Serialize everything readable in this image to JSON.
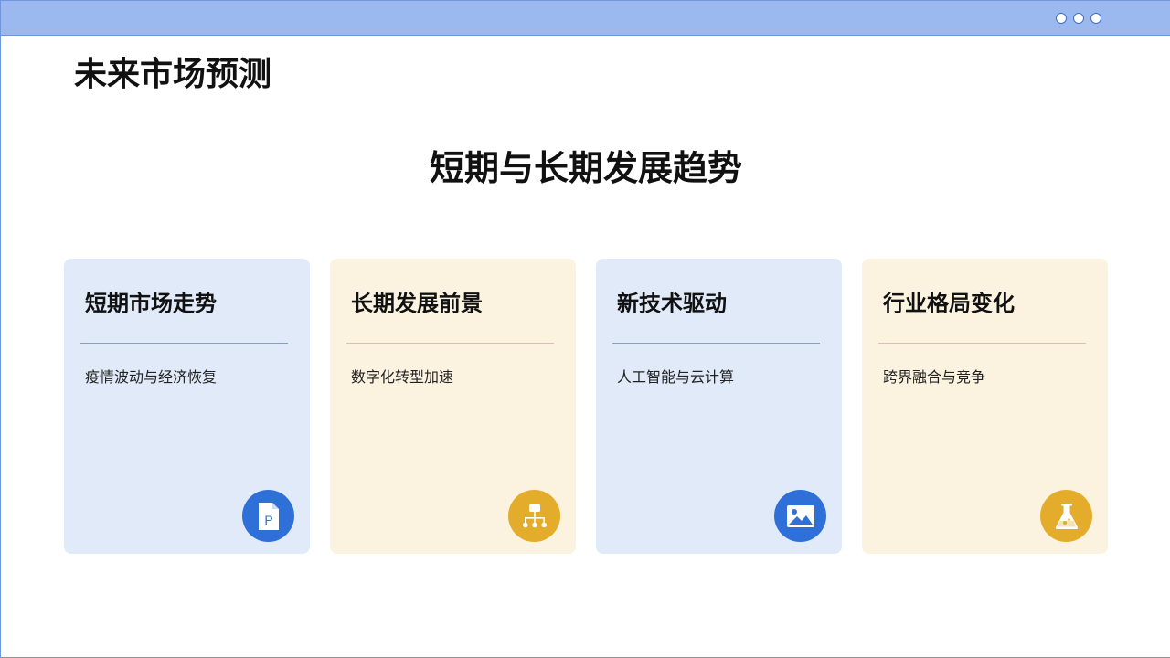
{
  "window": {
    "controls": [
      "circle-icon",
      "circle-icon",
      "circle-icon"
    ]
  },
  "page": {
    "title": "未来市场预测",
    "subtitle": "短期与长期发展趋势"
  },
  "cards": [
    {
      "title": "短期市场走势",
      "text": "疫情波动与经济恢复",
      "icon": "powerpoint-document-icon",
      "theme": "blue"
    },
    {
      "title": "长期发展前景",
      "text": "数字化转型加速",
      "icon": "org-chart-icon",
      "theme": "yellow"
    },
    {
      "title": "新技术驱动",
      "text": "人工智能与云计算",
      "icon": "image-icon",
      "theme": "blue"
    },
    {
      "title": "行业格局变化",
      "text": "跨界融合与竞争",
      "icon": "flask-icon",
      "theme": "yellow"
    }
  ],
  "colors": {
    "top_bar": "#9bb9ee",
    "border": "#6f95dd",
    "card_blue": "#e1eaf9",
    "card_yellow": "#fbf2e0",
    "icon_blue": "#2f6fd8",
    "icon_yellow": "#e3ac2b"
  }
}
